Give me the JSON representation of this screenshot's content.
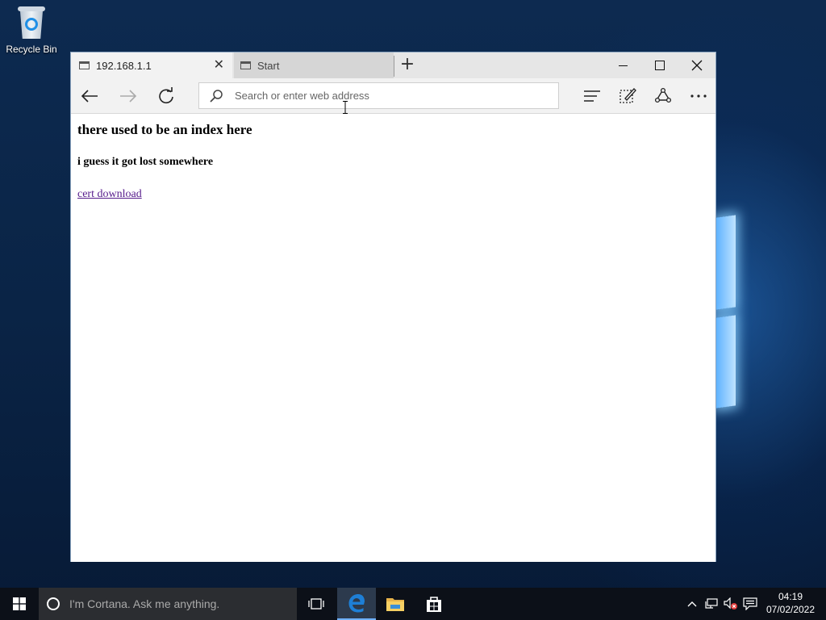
{
  "desktop": {
    "icons": [
      {
        "label": "Recycle Bin",
        "icon": "recycle-bin-icon"
      }
    ]
  },
  "browser": {
    "tabs": [
      {
        "title": "192.168.1.1",
        "active": true
      },
      {
        "title": "Start",
        "active": false
      }
    ],
    "address_bar": {
      "value": "",
      "placeholder": "Search or enter web address"
    },
    "toolbar_icons": [
      "back-icon",
      "forward-icon",
      "refresh-icon",
      "hub-icon",
      "web-note-icon",
      "share-icon",
      "more-icon"
    ],
    "page": {
      "heading": "there used to be an index here",
      "subheading": "i guess it got lost somewhere",
      "link": "cert download",
      "link_color": "#551a8b"
    }
  },
  "taskbar": {
    "search_placeholder": "I'm Cortana. Ask me anything.",
    "pinned": [
      "task-view-icon",
      "edge-icon",
      "file-explorer-icon",
      "store-icon"
    ],
    "clock": {
      "time": "04:19",
      "date": "07/02/2022"
    }
  },
  "colors": {
    "taskbar": "#0c1018",
    "accent": "#6fb1ff",
    "edge_blue": "#1e7fd6"
  }
}
